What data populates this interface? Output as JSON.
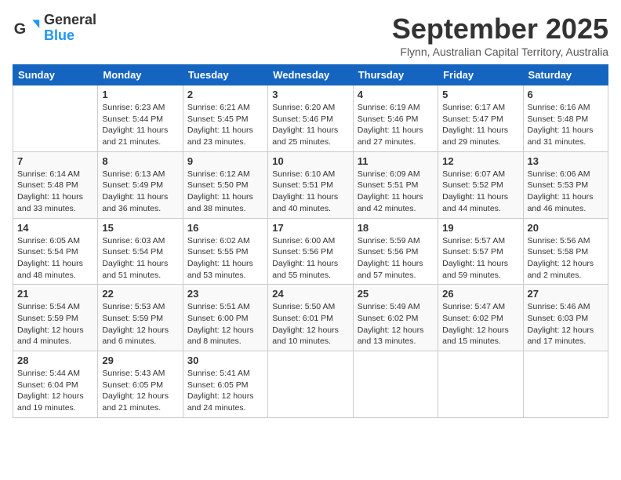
{
  "header": {
    "logo_general": "General",
    "logo_blue": "Blue",
    "title": "September 2025",
    "subtitle": "Flynn, Australian Capital Territory, Australia"
  },
  "days_of_week": [
    "Sunday",
    "Monday",
    "Tuesday",
    "Wednesday",
    "Thursday",
    "Friday",
    "Saturday"
  ],
  "weeks": [
    [
      {
        "day": "",
        "info": ""
      },
      {
        "day": "1",
        "info": "Sunrise: 6:23 AM\nSunset: 5:44 PM\nDaylight: 11 hours\nand 21 minutes."
      },
      {
        "day": "2",
        "info": "Sunrise: 6:21 AM\nSunset: 5:45 PM\nDaylight: 11 hours\nand 23 minutes."
      },
      {
        "day": "3",
        "info": "Sunrise: 6:20 AM\nSunset: 5:46 PM\nDaylight: 11 hours\nand 25 minutes."
      },
      {
        "day": "4",
        "info": "Sunrise: 6:19 AM\nSunset: 5:46 PM\nDaylight: 11 hours\nand 27 minutes."
      },
      {
        "day": "5",
        "info": "Sunrise: 6:17 AM\nSunset: 5:47 PM\nDaylight: 11 hours\nand 29 minutes."
      },
      {
        "day": "6",
        "info": "Sunrise: 6:16 AM\nSunset: 5:48 PM\nDaylight: 11 hours\nand 31 minutes."
      }
    ],
    [
      {
        "day": "7",
        "info": "Sunrise: 6:14 AM\nSunset: 5:48 PM\nDaylight: 11 hours\nand 33 minutes."
      },
      {
        "day": "8",
        "info": "Sunrise: 6:13 AM\nSunset: 5:49 PM\nDaylight: 11 hours\nand 36 minutes."
      },
      {
        "day": "9",
        "info": "Sunrise: 6:12 AM\nSunset: 5:50 PM\nDaylight: 11 hours\nand 38 minutes."
      },
      {
        "day": "10",
        "info": "Sunrise: 6:10 AM\nSunset: 5:51 PM\nDaylight: 11 hours\nand 40 minutes."
      },
      {
        "day": "11",
        "info": "Sunrise: 6:09 AM\nSunset: 5:51 PM\nDaylight: 11 hours\nand 42 minutes."
      },
      {
        "day": "12",
        "info": "Sunrise: 6:07 AM\nSunset: 5:52 PM\nDaylight: 11 hours\nand 44 minutes."
      },
      {
        "day": "13",
        "info": "Sunrise: 6:06 AM\nSunset: 5:53 PM\nDaylight: 11 hours\nand 46 minutes."
      }
    ],
    [
      {
        "day": "14",
        "info": "Sunrise: 6:05 AM\nSunset: 5:54 PM\nDaylight: 11 hours\nand 48 minutes."
      },
      {
        "day": "15",
        "info": "Sunrise: 6:03 AM\nSunset: 5:54 PM\nDaylight: 11 hours\nand 51 minutes."
      },
      {
        "day": "16",
        "info": "Sunrise: 6:02 AM\nSunset: 5:55 PM\nDaylight: 11 hours\nand 53 minutes."
      },
      {
        "day": "17",
        "info": "Sunrise: 6:00 AM\nSunset: 5:56 PM\nDaylight: 11 hours\nand 55 minutes."
      },
      {
        "day": "18",
        "info": "Sunrise: 5:59 AM\nSunset: 5:56 PM\nDaylight: 11 hours\nand 57 minutes."
      },
      {
        "day": "19",
        "info": "Sunrise: 5:57 AM\nSunset: 5:57 PM\nDaylight: 11 hours\nand 59 minutes."
      },
      {
        "day": "20",
        "info": "Sunrise: 5:56 AM\nSunset: 5:58 PM\nDaylight: 12 hours\nand 2 minutes."
      }
    ],
    [
      {
        "day": "21",
        "info": "Sunrise: 5:54 AM\nSunset: 5:59 PM\nDaylight: 12 hours\nand 4 minutes."
      },
      {
        "day": "22",
        "info": "Sunrise: 5:53 AM\nSunset: 5:59 PM\nDaylight: 12 hours\nand 6 minutes."
      },
      {
        "day": "23",
        "info": "Sunrise: 5:51 AM\nSunset: 6:00 PM\nDaylight: 12 hours\nand 8 minutes."
      },
      {
        "day": "24",
        "info": "Sunrise: 5:50 AM\nSunset: 6:01 PM\nDaylight: 12 hours\nand 10 minutes."
      },
      {
        "day": "25",
        "info": "Sunrise: 5:49 AM\nSunset: 6:02 PM\nDaylight: 12 hours\nand 13 minutes."
      },
      {
        "day": "26",
        "info": "Sunrise: 5:47 AM\nSunset: 6:02 PM\nDaylight: 12 hours\nand 15 minutes."
      },
      {
        "day": "27",
        "info": "Sunrise: 5:46 AM\nSunset: 6:03 PM\nDaylight: 12 hours\nand 17 minutes."
      }
    ],
    [
      {
        "day": "28",
        "info": "Sunrise: 5:44 AM\nSunset: 6:04 PM\nDaylight: 12 hours\nand 19 minutes."
      },
      {
        "day": "29",
        "info": "Sunrise: 5:43 AM\nSunset: 6:05 PM\nDaylight: 12 hours\nand 21 minutes."
      },
      {
        "day": "30",
        "info": "Sunrise: 5:41 AM\nSunset: 6:05 PM\nDaylight: 12 hours\nand 24 minutes."
      },
      {
        "day": "",
        "info": ""
      },
      {
        "day": "",
        "info": ""
      },
      {
        "day": "",
        "info": ""
      },
      {
        "day": "",
        "info": ""
      }
    ]
  ]
}
